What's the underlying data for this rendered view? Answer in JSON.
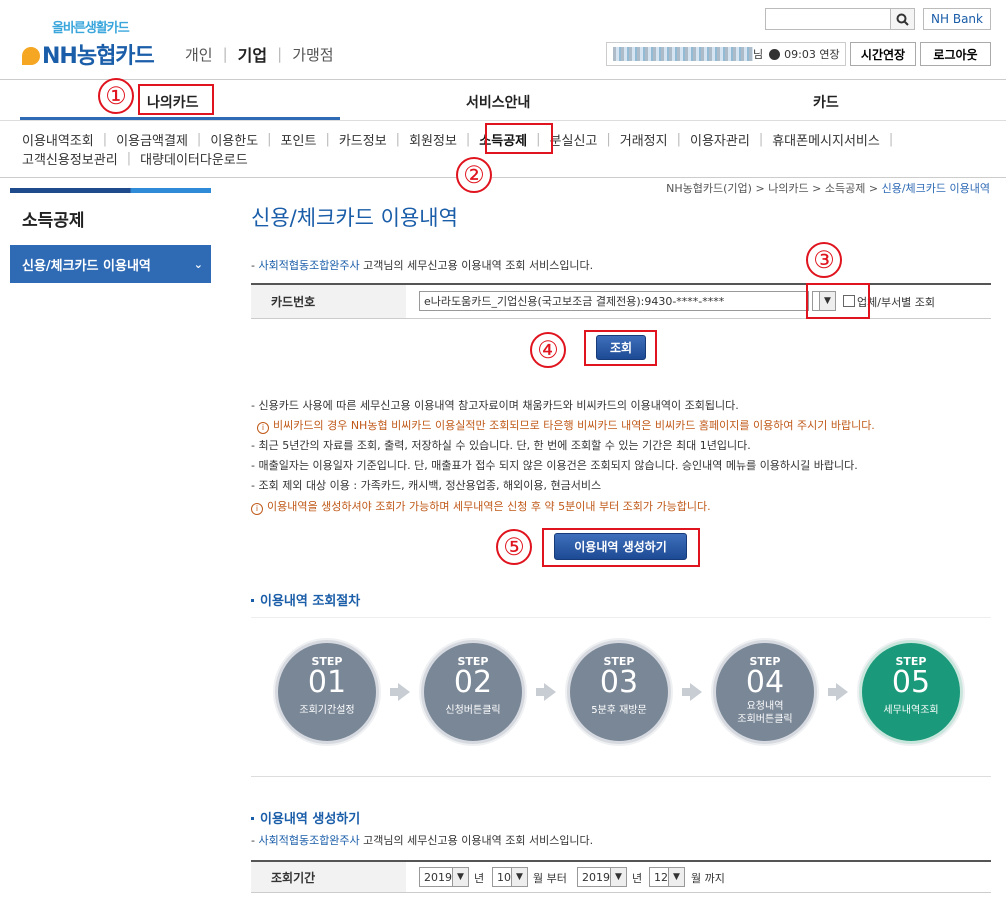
{
  "header": {
    "logo_tagline": "올바른생활카드",
    "logo_brand": "NH농협카드",
    "topnav": [
      "개인",
      "기업",
      "가맹점"
    ],
    "nh_bank_label": "NH Bank",
    "session_time": "09:03 연장",
    "user_suffix": "님",
    "extend_button": "시간연장",
    "logout_button": "로그아웃"
  },
  "gnb": {
    "tabs": [
      "나의카드",
      "서비스안내",
      "카드"
    ]
  },
  "subnav": {
    "row1": [
      "이용내역조회",
      "이용금액결제",
      "이용한도",
      "포인트",
      "카드정보",
      "회원정보",
      "소득공제",
      "분실신고",
      "거래정지",
      "이용자관리",
      "휴대폰메시지서비스"
    ],
    "row2": [
      "고객신용정보관리",
      "대량데이터다운로드"
    ]
  },
  "sidebar": {
    "title": "소득공제",
    "active_item": "신용/체크카드 이용내역"
  },
  "breadcrumb": {
    "items": [
      "NH농협카드(기업)",
      "나의카드",
      "소득공제"
    ],
    "current": "신용/체크카드 이용내역",
    "separator": ">"
  },
  "content": {
    "title": "신용/체크카드 이용내역",
    "intro_company": "사회적협동조합완주사",
    "intro_rest": " 고객님의 세무신고용 이용내역 조회 서비스입니다.",
    "card_label": "카드번호",
    "card_value": "e나라도움카드_기업신용(국고보조금 결제전용):9430-****-****",
    "dept_checkbox_label": "업체/부서별 조회",
    "search_button": "조회",
    "notes": [
      "- 신용카드 사용에 따른 세무신고용 이용내역 참고자료이며 채움카드와 비씨카드의 이용내역이 조회됩니다.",
      "비씨카드의 경우 NH농협 비씨카드 이용실적만 조회되므로 타은행 비씨카드 내역은 비씨카드 홈페이지를 이용하여 주시기 바랍니다.",
      "- 최근 5년간의 자료를 조회, 출력, 저장하실 수 있습니다. 단, 한 번에 조회할 수 있는 기간은 최대 1년입니다.",
      "- 매출일자는 이용일자 기준입니다. 단, 매출표가 접수 되지 않은 이용건은 조회되지 않습니다. 승인내역 메뉴를 이용하시길 바랍니다.",
      "- 조회 제외 대상 이용 : 가족카드, 캐시백, 정산용업종, 해외이용, 현금서비스",
      "이용내역을 생성하셔야 조회가 가능하며 세무내역은 신청 후 약 5분이내 부터 조회가 가능합니다."
    ],
    "generate_button": "이용내역 생성하기",
    "procedure_title": "이용내역 조회절차",
    "steps": [
      {
        "label": "STEP",
        "num": "01",
        "desc": "조회기간설정"
      },
      {
        "label": "STEP",
        "num": "02",
        "desc": "신청버튼클릭"
      },
      {
        "label": "STEP",
        "num": "03",
        "desc": "5분후 재방문"
      },
      {
        "label": "STEP",
        "num": "04",
        "desc": "요청내역\n조회버튼클릭"
      },
      {
        "label": "STEP",
        "num": "05",
        "desc": "세무내역조회"
      }
    ],
    "generate_title": "이용내역 생성하기",
    "period_label": "조회기간",
    "period": {
      "from_year": "2019",
      "from_month": "10",
      "to_year": "2019",
      "to_month": "12",
      "year_unit": "년",
      "month_unit": "월",
      "from_word": "부터",
      "to_word": "까지"
    }
  },
  "annotations": [
    "①",
    "②",
    "③",
    "④",
    "⑤"
  ],
  "colors": {
    "accent": "#2f6bb5",
    "annotation": "#e0141e",
    "warning": "#c05a1a",
    "step_green": "#1a9a7a",
    "step_gray": "#7a8797"
  }
}
